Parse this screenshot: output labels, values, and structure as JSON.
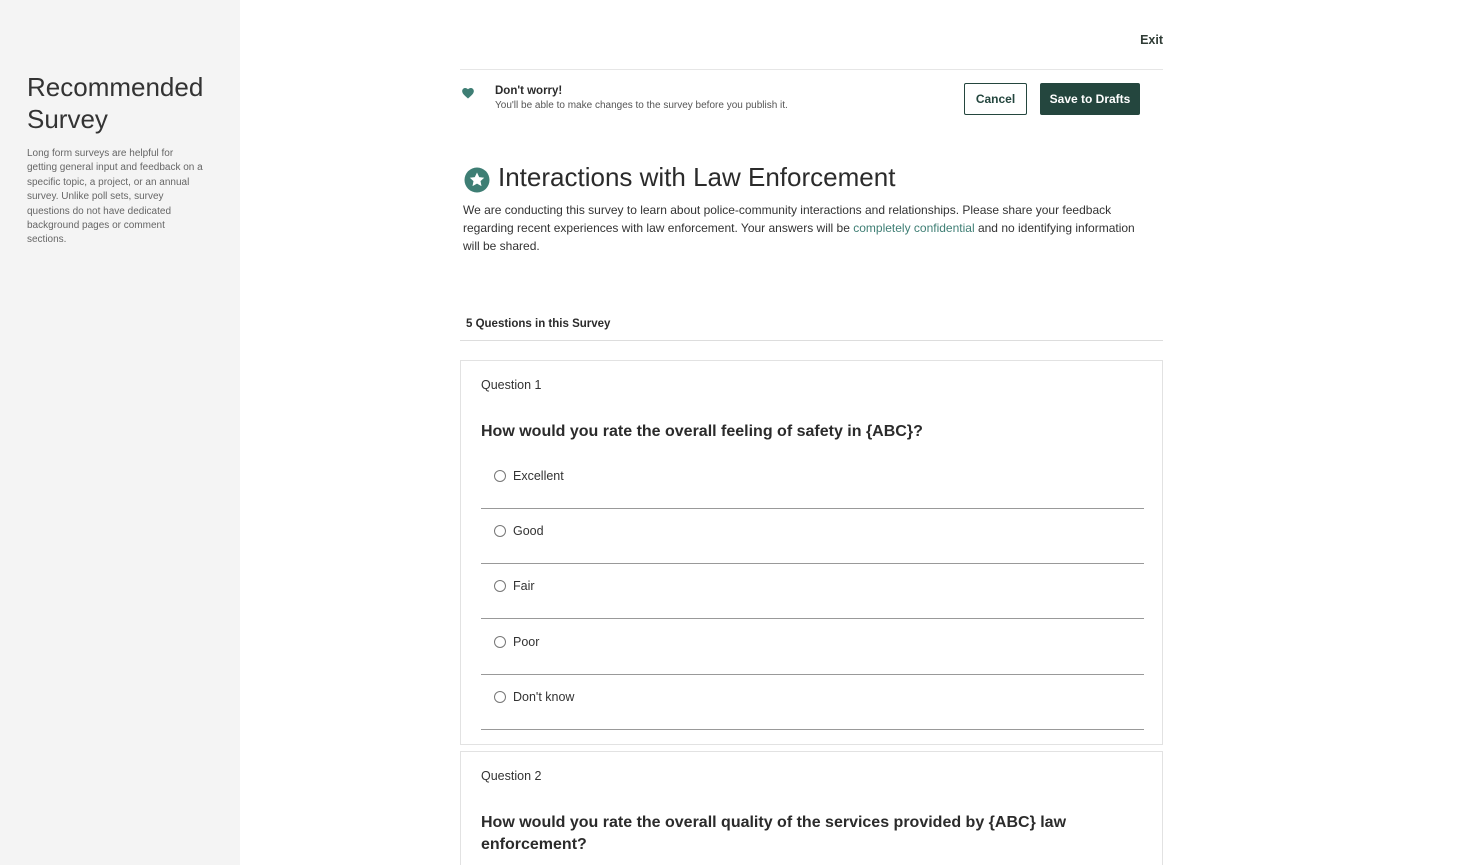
{
  "sidebar": {
    "title": "Recommended Survey",
    "description": "Long form surveys are helpful for getting general input and feedback on a specific topic, a project, or an annual survey. Unlike poll sets, survey questions do not have dedicated background pages or comment sections."
  },
  "header": {
    "exit_label": "Exit"
  },
  "notice": {
    "icon": "heart-icon",
    "title": "Don't worry!",
    "subtitle": "You'll be able to make changes to the survey before you publish it."
  },
  "actions": {
    "cancel_label": "Cancel",
    "save_label": "Save to Drafts"
  },
  "survey": {
    "icon": "star-badge-icon",
    "title": "Interactions with Law Enforcement",
    "description_before": "We are conducting this survey to learn about police-community interactions and relationships. Please share your feedback regarding recent experiences with law enforcement. Your answers will be ",
    "description_link": "completely confidential",
    "description_after": " and no identifying information will be shared.",
    "question_count": "5 Questions in this Survey"
  },
  "questions": [
    {
      "label": "Question 1",
      "text": "How would you rate the overall feeling of safety in {ABC}?",
      "options": [
        "Excellent",
        "Good",
        "Fair",
        "Poor",
        "Don't know"
      ]
    },
    {
      "label": "Question 2",
      "text": "How would you rate the overall quality of the services provided by {ABC} law enforcement?"
    }
  ],
  "colors": {
    "primary": "#24463e",
    "accent": "#3e7e74",
    "sidebar_bg": "#f4f4f4"
  }
}
